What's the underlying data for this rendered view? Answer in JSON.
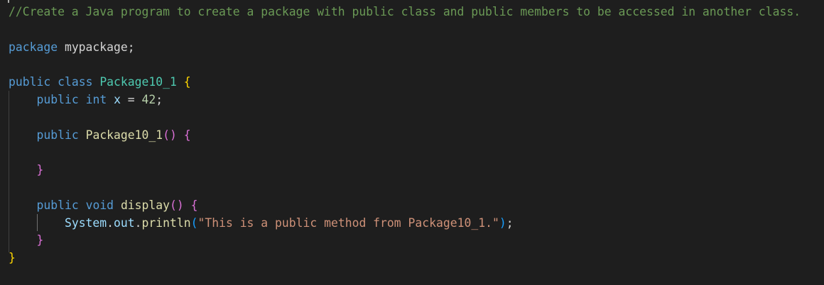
{
  "editor": {
    "language": "java",
    "theme_colors": {
      "background": "#1e1e1e",
      "comment": "#6a9955",
      "keyword": "#569cd6",
      "type": "#4ec9b0",
      "function": "#dcdcaa",
      "variable": "#9cdcfe",
      "plain": "#d4d4d4",
      "number": "#b5cea8",
      "string": "#ce9178",
      "bracket_level_1": "#ffd700",
      "bracket_level_2": "#da70d6",
      "bracket_level_3": "#179fff"
    },
    "lines": [
      [
        {
          "t": "//Create a Java program to create a package with public class and public members to be accessed in another class.",
          "c": "comment"
        }
      ],
      [],
      [
        {
          "t": "package",
          "c": "keyword"
        },
        {
          "t": " mypackage;",
          "c": "plain"
        }
      ],
      [],
      [
        {
          "t": "public",
          "c": "keyword"
        },
        {
          "t": " ",
          "c": "plain"
        },
        {
          "t": "class",
          "c": "keyword"
        },
        {
          "t": " ",
          "c": "plain"
        },
        {
          "t": "Package10_1",
          "c": "type"
        },
        {
          "t": " ",
          "c": "plain"
        },
        {
          "t": "{",
          "c": "b1"
        }
      ],
      [
        {
          "t": "    ",
          "c": "plain"
        },
        {
          "t": "public",
          "c": "keyword"
        },
        {
          "t": " ",
          "c": "plain"
        },
        {
          "t": "int",
          "c": "keyword"
        },
        {
          "t": " ",
          "c": "plain"
        },
        {
          "t": "x",
          "c": "var"
        },
        {
          "t": " = ",
          "c": "plain"
        },
        {
          "t": "42",
          "c": "num"
        },
        {
          "t": ";",
          "c": "plain"
        }
      ],
      [],
      [
        {
          "t": "    ",
          "c": "plain"
        },
        {
          "t": "public",
          "c": "keyword"
        },
        {
          "t": " ",
          "c": "plain"
        },
        {
          "t": "Package10_1",
          "c": "func"
        },
        {
          "t": "()",
          "c": "b2"
        },
        {
          "t": " ",
          "c": "plain"
        },
        {
          "t": "{",
          "c": "b2"
        }
      ],
      [],
      [
        {
          "t": "    ",
          "c": "plain"
        },
        {
          "t": "}",
          "c": "b2"
        }
      ],
      [],
      [
        {
          "t": "    ",
          "c": "plain"
        },
        {
          "t": "public",
          "c": "keyword"
        },
        {
          "t": " ",
          "c": "plain"
        },
        {
          "t": "void",
          "c": "keyword"
        },
        {
          "t": " ",
          "c": "plain"
        },
        {
          "t": "display",
          "c": "func"
        },
        {
          "t": "()",
          "c": "b2"
        },
        {
          "t": " ",
          "c": "plain"
        },
        {
          "t": "{",
          "c": "b2"
        }
      ],
      [
        {
          "t": "        ",
          "c": "plain"
        },
        {
          "t": "System",
          "c": "var"
        },
        {
          "t": ".",
          "c": "plain"
        },
        {
          "t": "out",
          "c": "var"
        },
        {
          "t": ".",
          "c": "plain"
        },
        {
          "t": "println",
          "c": "func"
        },
        {
          "t": "(",
          "c": "b3"
        },
        {
          "t": "\"This is a public method from Package10_1.\"",
          "c": "str"
        },
        {
          "t": ")",
          "c": "b3"
        },
        {
          "t": ";",
          "c": "plain"
        }
      ],
      [
        {
          "t": "    ",
          "c": "plain"
        },
        {
          "t": "}",
          "c": "b2"
        }
      ],
      [
        {
          "t": "}",
          "c": "b1"
        }
      ]
    ]
  }
}
